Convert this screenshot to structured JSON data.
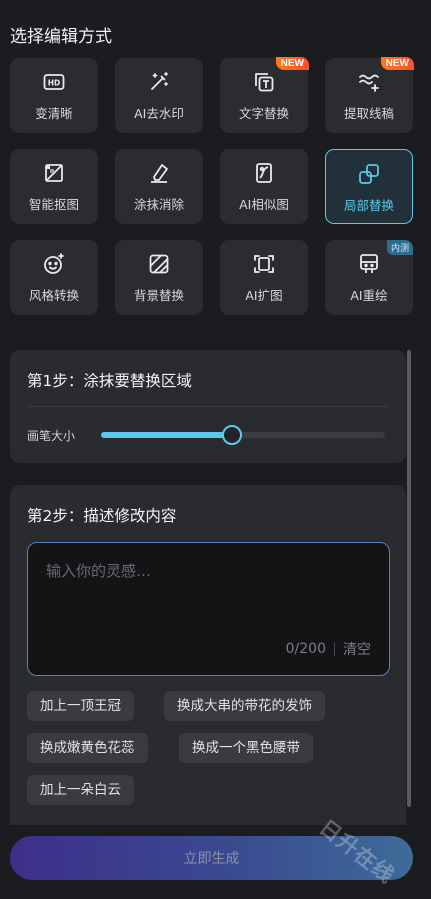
{
  "header": {
    "title": "选择编辑方式"
  },
  "tools": [
    {
      "label": "变清晰",
      "icon": "hd-icon",
      "badge": ""
    },
    {
      "label": "AI去水印",
      "icon": "magic-wand-icon",
      "badge": ""
    },
    {
      "label": "文字替换",
      "icon": "text-replace-icon",
      "badge": "NEW"
    },
    {
      "label": "提取线稿",
      "icon": "line-art-icon",
      "badge": "NEW"
    },
    {
      "label": "智能抠图",
      "icon": "cutout-icon",
      "badge": ""
    },
    {
      "label": "涂抹消除",
      "icon": "eraser-icon",
      "badge": ""
    },
    {
      "label": "AI相似图",
      "icon": "similar-image-icon",
      "badge": ""
    },
    {
      "label": "局部替换",
      "icon": "partial-replace-icon",
      "badge": "",
      "active": true
    },
    {
      "label": "风格转换",
      "icon": "style-transfer-icon",
      "badge": ""
    },
    {
      "label": "背景替换",
      "icon": "background-replace-icon",
      "badge": ""
    },
    {
      "label": "AI扩图",
      "icon": "expand-image-icon",
      "badge": ""
    },
    {
      "label": "AI重绘",
      "icon": "repaint-icon",
      "badge": "内测"
    }
  ],
  "step1": {
    "title": "第1步：涂抹要替换区域",
    "brush_label": "画笔大小",
    "brush_level": 0.46
  },
  "step2": {
    "title": "第2步：描述修改内容",
    "placeholder": "输入你的灵感…",
    "counter": "0/200",
    "clear_label": "清空",
    "suggestions": [
      "加上一顶王冠",
      "换成大串的带花的发饰",
      "换成嫩黄色花蕊",
      "换成一个黑色腰带",
      "加上一朵白云"
    ]
  },
  "generate_button": "立即生成",
  "watermark": "日升在线",
  "colors": {
    "accent": "#5bc9ec",
    "background": "#1b1c1f",
    "card": "#2a2b2f",
    "badge_new": "#ff5a23"
  }
}
